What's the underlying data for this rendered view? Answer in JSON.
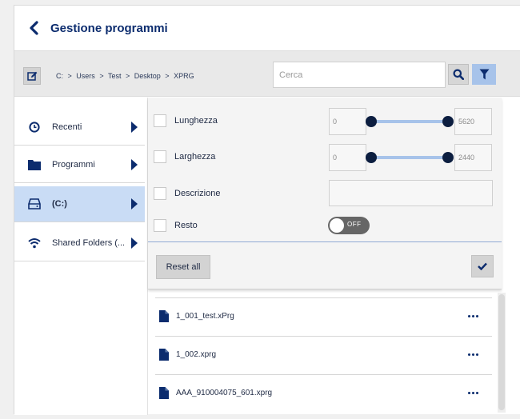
{
  "header": {
    "title": "Gestione programmi"
  },
  "toolbar": {
    "breadcrumb": [
      "C:",
      ">",
      "Users",
      ">",
      "Test",
      ">",
      "Desktop",
      ">",
      "XPRG"
    ],
    "search_placeholder": "Cerca"
  },
  "sidebar": {
    "items": [
      {
        "label": "Recenti",
        "icon": "clock-icon",
        "active": false
      },
      {
        "label": "Programmi",
        "icon": "folder-icon",
        "active": false
      },
      {
        "label": "(C:)",
        "icon": "drive-icon",
        "active": true
      },
      {
        "label": "Shared Folders (...",
        "icon": "wifi-icon",
        "active": false
      }
    ]
  },
  "filters": {
    "length": {
      "label": "Lunghezza",
      "min": "0",
      "max": "5620"
    },
    "width": {
      "label": "Larghezza",
      "min": "0",
      "max": "2440"
    },
    "description": {
      "label": "Descrizione"
    },
    "rest": {
      "label": "Resto",
      "toggle": "OFF"
    },
    "reset_label": "Reset all"
  },
  "files": [
    {
      "name": "1_001_test.xPrg"
    },
    {
      "name": "1_002.xprg"
    },
    {
      "name": "AAA_910004075_601.xprg"
    }
  ],
  "colors": {
    "accent": "#0c2c6e",
    "selection": "#c9dcf5",
    "filter_button": "#a7c3ea"
  }
}
